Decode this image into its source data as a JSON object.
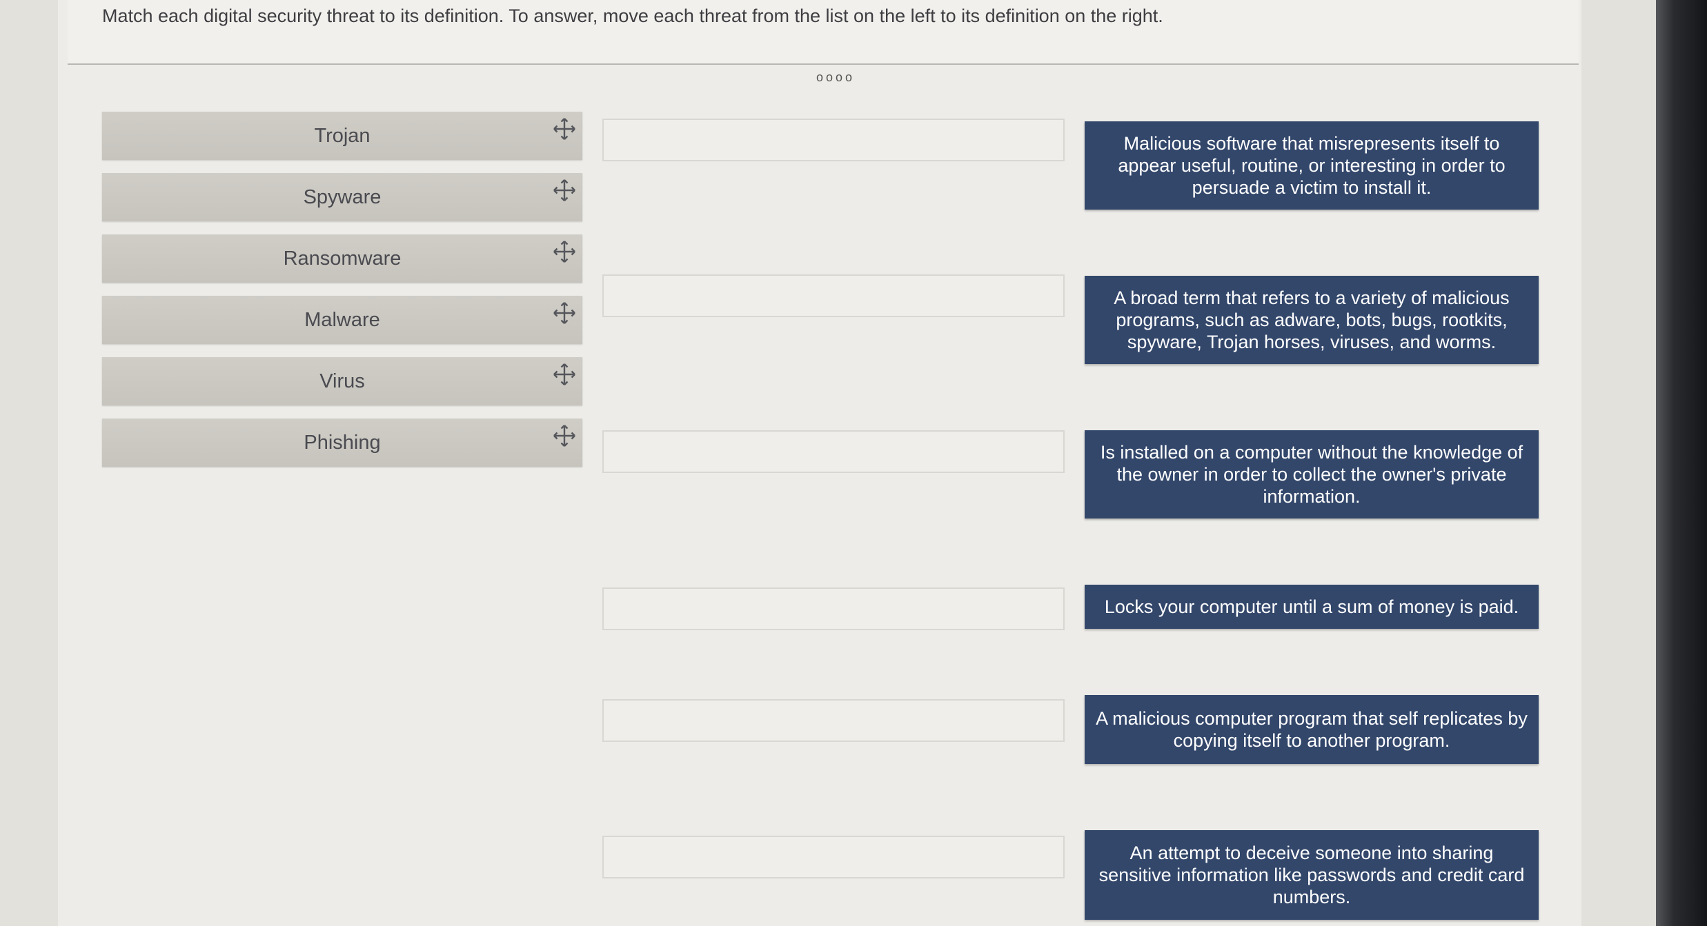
{
  "instructions": "Match each digital security threat to its definition. To answer, move each threat from the list on the left to its definition on the right.",
  "pager_dots": "oooo",
  "threats": [
    {
      "label": "Trojan"
    },
    {
      "label": "Spyware"
    },
    {
      "label": "Ransomware"
    },
    {
      "label": "Malware"
    },
    {
      "label": "Virus"
    },
    {
      "label": "Phishing"
    }
  ],
  "definitions": [
    {
      "text": "Malicious software that misrepresents itself to appear useful, routine, or interesting in order to persuade a victim to install it."
    },
    {
      "text": "A broad term that refers to a variety of malicious programs, such as adware, bots, bugs, rootkits, spyware, Trojan horses, viruses, and worms."
    },
    {
      "text": "Is installed on a computer without the knowledge of the owner in order to collect the owner's private information."
    },
    {
      "text": "Locks your computer until a sum of money is paid."
    },
    {
      "text": "A malicious computer program that self replicates by copying itself to another program."
    },
    {
      "text": "An attempt to deceive someone into sharing sensitive information like passwords and credit card numbers."
    }
  ],
  "icons": {
    "drag_handle": "move-arrows-icon"
  },
  "colors": {
    "definition_bg": "#33476b",
    "threat_bg": "#cbc9c2"
  }
}
